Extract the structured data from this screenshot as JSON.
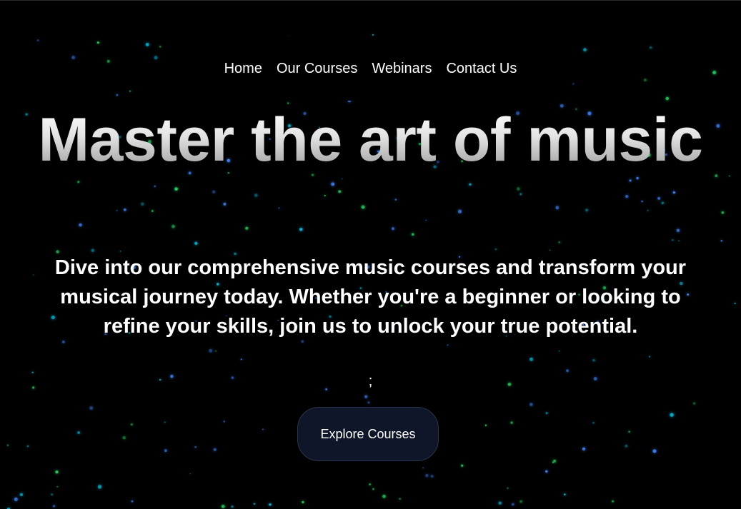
{
  "nav": {
    "items": [
      {
        "label": "Home"
      },
      {
        "label": "Our Courses"
      },
      {
        "label": "Webinars"
      },
      {
        "label": "Contact Us"
      }
    ]
  },
  "hero": {
    "title": "Master the art of music",
    "subtitle": "Dive into our comprehensive music courses and transform your musical journey today. Whether you're a beginner or looking to refine your skills, join us to unlock your true potential.",
    "stray_text": ";",
    "cta_label": "Explore Courses"
  },
  "theme": {
    "background": "#000000",
    "text": "#ffffff",
    "button_background": "#0f1629",
    "particle_colors": [
      "#22c55e",
      "#3b82f6",
      "#06b6d4"
    ]
  }
}
